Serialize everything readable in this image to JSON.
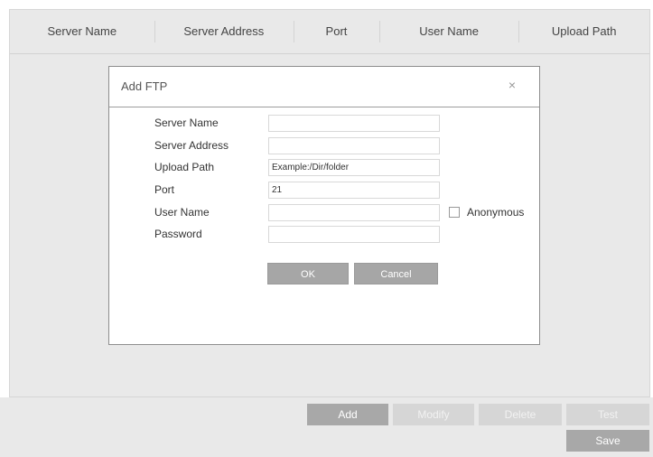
{
  "table": {
    "headers": [
      "Server Name",
      "Server Address",
      "Port",
      "User Name",
      "Upload Path"
    ]
  },
  "toolbar": {
    "add_label": "Add",
    "modify_label": "Modify",
    "delete_label": "Delete",
    "test_label": "Test",
    "save_label": "Save"
  },
  "dialog": {
    "title": "Add FTP",
    "close_symbol": "×",
    "fields": {
      "server_name": {
        "label": "Server Name",
        "value": ""
      },
      "server_address": {
        "label": "Server Address",
        "value": ""
      },
      "upload_path": {
        "label": "Upload Path",
        "value": "Example:/Dir/folder"
      },
      "port": {
        "label": "Port",
        "value": "21"
      },
      "user_name": {
        "label": "User Name",
        "value": ""
      },
      "password": {
        "label": "Password",
        "value": ""
      }
    },
    "anonymous_label": "Anonymous",
    "anonymous_checked": false,
    "ok_label": "OK",
    "cancel_label": "Cancel"
  }
}
